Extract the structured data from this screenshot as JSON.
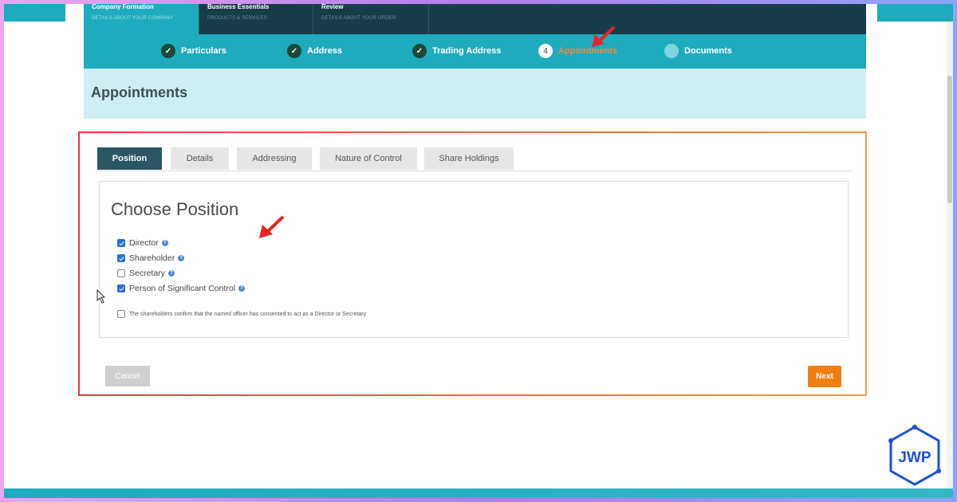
{
  "top_tabs": [
    {
      "title": "Company Formation",
      "subtitle": "DETAILS ABOUT YOUR COMPANY"
    },
    {
      "title": "Business Essentials",
      "subtitle": "PRODUCTS & SERVICES"
    },
    {
      "title": "Review",
      "subtitle": "DETAILS ABOUT YOUR ORDER"
    }
  ],
  "steps": [
    {
      "label": "Particulars",
      "state": "done"
    },
    {
      "label": "Address",
      "state": "done"
    },
    {
      "label": "Trading Address",
      "state": "done"
    },
    {
      "number": "4",
      "label": "Appointments",
      "state": "current"
    },
    {
      "label": "Documents",
      "state": "pending"
    }
  ],
  "page_title": "Appointments",
  "form_tabs": [
    "Position",
    "Details",
    "Addressing",
    "Nature of Control",
    "Share Holdings"
  ],
  "section_title": "Choose Position",
  "positions": [
    {
      "label": "Director",
      "checked": true
    },
    {
      "label": "Shareholder",
      "checked": true
    },
    {
      "label": "Secretary",
      "checked": false
    },
    {
      "label": "Person of Significant Control",
      "checked": true
    }
  ],
  "consent_text": "The shareholders confirm that the named officer has consented to act as a Director or Secretary",
  "buttons": {
    "cancel": "Cancel",
    "next": "Next"
  },
  "logo_text": "JWP",
  "colors": {
    "teal": "#1eabbd",
    "dark_navy": "#173d48",
    "orange": "#f07f13",
    "highlight_red": "#e8344a"
  }
}
